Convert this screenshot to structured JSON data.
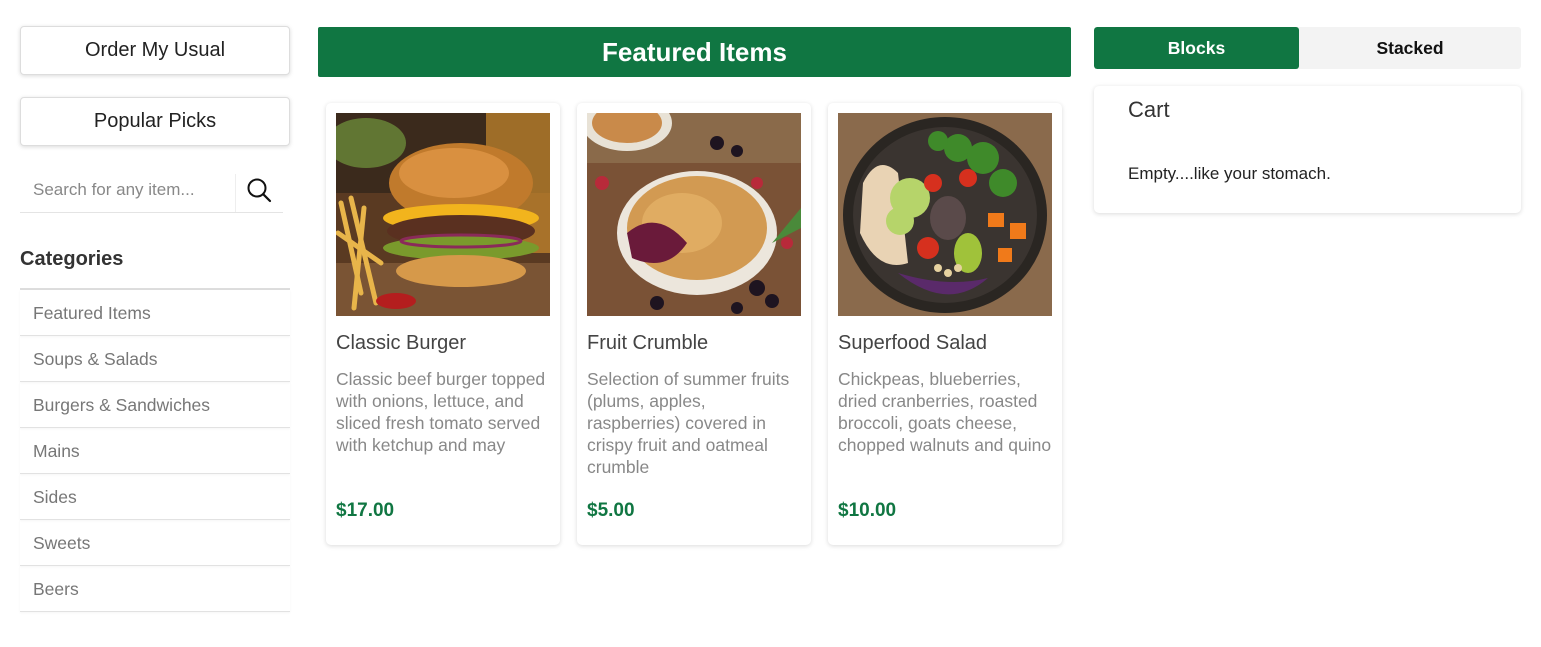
{
  "sidebar": {
    "order_usual_label": "Order My Usual",
    "popular_picks_label": "Popular Picks",
    "search": {
      "placeholder": "Search for any item..."
    },
    "categories_title": "Categories",
    "categories": [
      "Featured Items",
      "Soups & Salads",
      "Burgers & Sandwiches",
      "Mains",
      "Sides",
      "Sweets",
      "Beers"
    ]
  },
  "main": {
    "banner_title": "Featured Items",
    "items": [
      {
        "name": "Classic Burger",
        "description": "Classic beef burger topped with onions, lettuce, and sliced fresh tomato served with ketchup and may",
        "price": "$17.00",
        "image": "burger-photo"
      },
      {
        "name": "Fruit Crumble",
        "description": "Selection of summer fruits (plums, apples, raspberries) covered in crispy fruit and oatmeal crumble",
        "price": "$5.00",
        "image": "crumble-photo"
      },
      {
        "name": "Superfood Salad",
        "description": "Chickpeas, blueberries, dried cranberries, roasted broccoli, goats cheese, chopped walnuts and quino",
        "price": "$10.00",
        "image": "salad-photo"
      }
    ]
  },
  "view_toggle": {
    "blocks_label": "Blocks",
    "stacked_label": "Stacked",
    "selected": "Blocks"
  },
  "cart": {
    "title": "Cart",
    "empty_text": "Empty....like your stomach."
  },
  "colors": {
    "brand_green": "#107642",
    "toggle_inactive_bg": "#f3f3f3"
  }
}
